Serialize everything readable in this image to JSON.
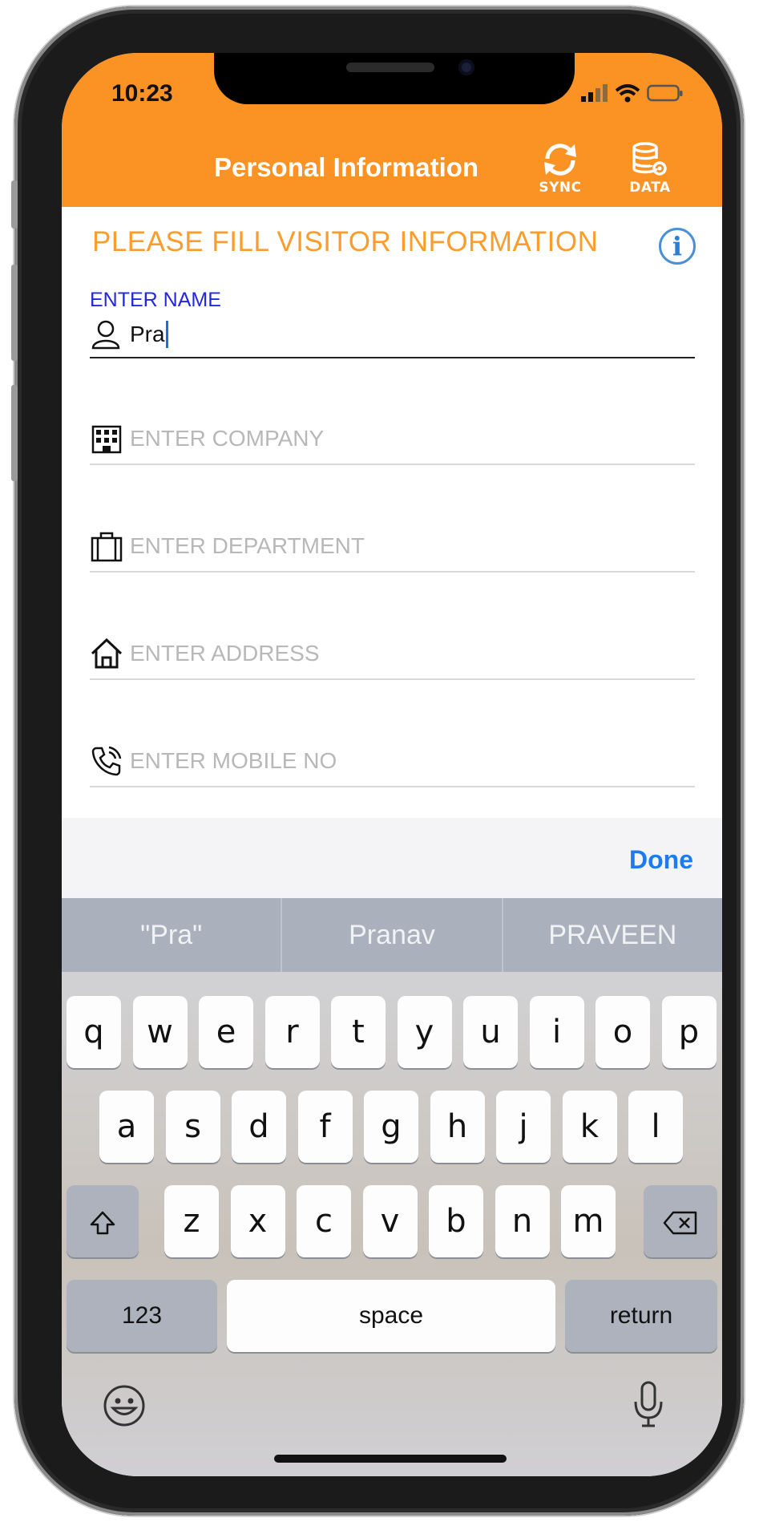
{
  "status": {
    "time": "10:23"
  },
  "navbar": {
    "title": "Personal Information",
    "sync_label": "SYNC",
    "data_label": "DATA",
    "color": "#fb9224"
  },
  "form": {
    "heading": "PLEASE FILL VISITOR INFORMATION",
    "name": {
      "label": "ENTER NAME",
      "value": "Pra"
    },
    "company": {
      "placeholder": "ENTER COMPANY"
    },
    "department": {
      "placeholder": "ENTER DEPARTMENT"
    },
    "address": {
      "placeholder": "ENTER ADDRESS"
    },
    "mobile": {
      "placeholder": "ENTER MOBILE NO"
    }
  },
  "accessory": {
    "done_label": "Done"
  },
  "keyboard": {
    "suggestions": [
      "\"Pra\"",
      "Pranav",
      "PRAVEEN"
    ],
    "row1": [
      "q",
      "w",
      "e",
      "r",
      "t",
      "y",
      "u",
      "i",
      "o",
      "p"
    ],
    "row2": [
      "a",
      "s",
      "d",
      "f",
      "g",
      "h",
      "j",
      "k",
      "l"
    ],
    "row3": [
      "z",
      "x",
      "c",
      "v",
      "b",
      "n",
      "m"
    ],
    "numbers_label": "123",
    "space_label": "space",
    "return_label": "return"
  }
}
